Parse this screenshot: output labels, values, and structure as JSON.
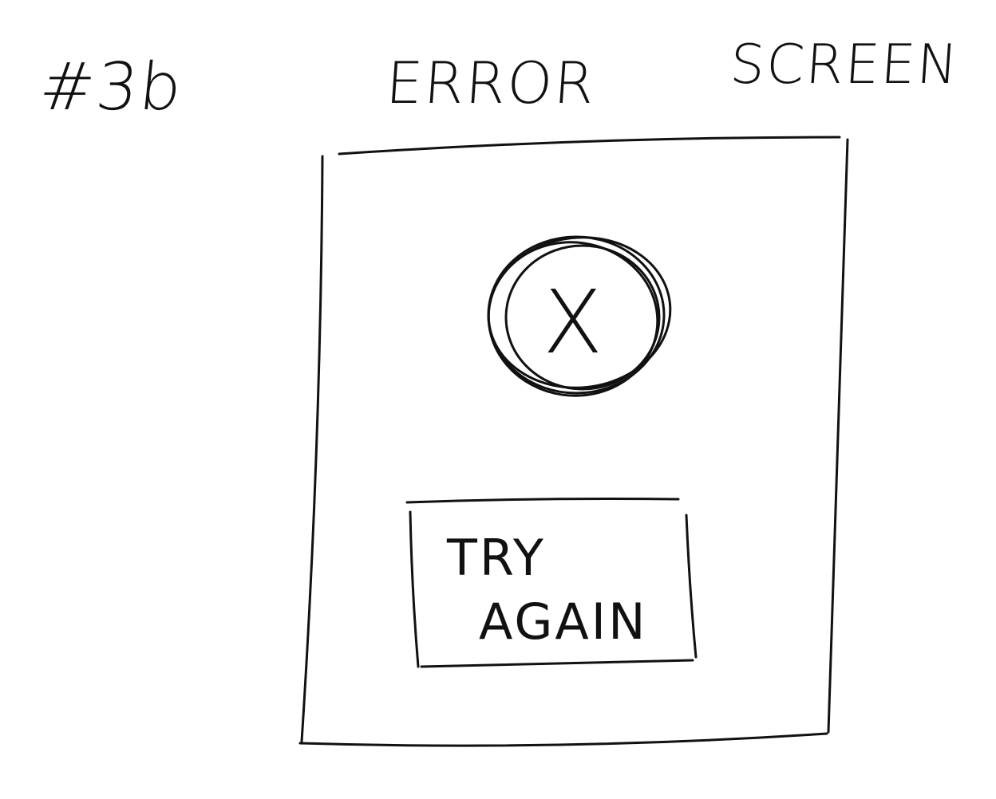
{
  "header": {
    "number": "#3b",
    "word1": "ERROR",
    "word2": "SCREEN"
  },
  "screen": {
    "error_icon": "x-circle-icon",
    "error_glyph": "X",
    "button": {
      "line1": "TRY",
      "line2": "AGAIN"
    }
  }
}
